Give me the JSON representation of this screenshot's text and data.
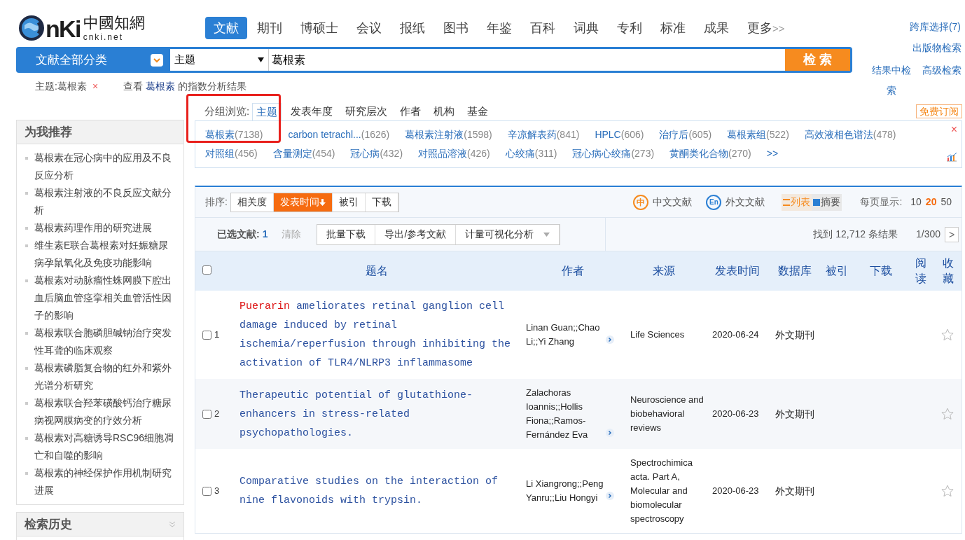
{
  "logo": {
    "letters": "nKi",
    "name": "中國知網",
    "domain": "cnki.net"
  },
  "nav": [
    {
      "label": "文献",
      "selected": true
    },
    {
      "label": "期刊",
      "selected": false
    },
    {
      "label": "博硕士",
      "selected": false
    },
    {
      "label": "会议",
      "selected": false
    },
    {
      "label": "报纸",
      "selected": false
    },
    {
      "label": "图书",
      "selected": false
    },
    {
      "label": "年鉴",
      "selected": false
    },
    {
      "label": "百科",
      "selected": false
    },
    {
      "label": "词典",
      "selected": false
    },
    {
      "label": "专利",
      "selected": false
    },
    {
      "label": "标准",
      "selected": false
    },
    {
      "label": "成果",
      "selected": false
    },
    {
      "label": "更多",
      "selected": false
    }
  ],
  "nav_more_icon": ">>",
  "search": {
    "category": "文献全部分类",
    "field": "主题",
    "value": "葛根素",
    "button": "检 索"
  },
  "right_links": [
    "跨库选择(7)",
    "出版物检索",
    "结果中检索",
    "高级检索"
  ],
  "filter": {
    "tag": "主题:葛根素",
    "remove": "×",
    "prefix": "查看",
    "keyword": "葛根素",
    "suffix": "的指数分析结果"
  },
  "sidebar": {
    "title": "为我推荐",
    "items": [
      "葛根素在冠心病中的应用及不良反应分析",
      "葛根素注射液的不良反应文献分析",
      "葛根素药理作用的研究进展",
      "维生素E联合葛根素对妊娠糖尿病孕鼠氧化及免疫功能影响",
      "葛根素对动脉瘤性蛛网膜下腔出血后脑血管痉挛相关血管活性因子的影响",
      "葛根素联合胞磷胆碱钠治疗突发性耳聋的临床观察",
      "葛根素磷脂复合物的红外和紫外光谱分析研究",
      "葛根素联合羟苯磺酸钙治疗糖尿病视网膜病变的疗效分析",
      "葛根素对高糖诱导RSC96细胞凋亡和自噬的影响",
      "葛根素的神经保护作用机制研究进展"
    ],
    "history_title": "检索历史"
  },
  "group_browse": {
    "label": "分组浏览:",
    "callout": true,
    "tabs": [
      {
        "label": "主题",
        "selected": true
      },
      {
        "label": "发表年度",
        "selected": false
      },
      {
        "label": "研究层次",
        "selected": false
      },
      {
        "label": "作者",
        "selected": false
      },
      {
        "label": "机构",
        "selected": false
      },
      {
        "label": "基金",
        "selected": false
      }
    ],
    "subscribe": "免费订阅",
    "close": "×",
    "terms": [
      {
        "name": "葛根素",
        "count": "(7138)"
      },
      {
        "name": "carbon tetrachl...",
        "count": "(1626)"
      },
      {
        "name": "葛根素注射液",
        "count": "(1598)"
      },
      {
        "name": "辛凉解表药",
        "count": "(841)"
      },
      {
        "name": "HPLC",
        "count": "(606)"
      },
      {
        "name": "治疗后",
        "count": "(605)"
      },
      {
        "name": "葛根素组",
        "count": "(522)"
      },
      {
        "name": "高效液相色谱法",
        "count": "(478)"
      },
      {
        "name": "对照组",
        "count": "(456)"
      },
      {
        "name": "含量测定",
        "count": "(454)"
      },
      {
        "name": "冠心病",
        "count": "(432)"
      },
      {
        "name": "对照品溶液",
        "count": "(426)"
      },
      {
        "name": "心绞痛",
        "count": "(311)"
      },
      {
        "name": "冠心病心绞痛",
        "count": "(273)"
      },
      {
        "name": "黄酮类化合物",
        "count": "(270)"
      }
    ],
    "more": ">>"
  },
  "sort": {
    "label": "排序:",
    "options": [
      {
        "label": "相关度",
        "selected": false
      },
      {
        "label": "发表时间",
        "selected": true
      },
      {
        "label": "被引",
        "selected": false
      },
      {
        "label": "下载",
        "selected": false
      }
    ]
  },
  "lang_filters": [
    {
      "kind": "zh",
      "icon": "中",
      "label": "中文文献"
    },
    {
      "kind": "en",
      "icon": "En",
      "label": "外文文献"
    }
  ],
  "view_modes": [
    {
      "label": "列表",
      "selected": true
    },
    {
      "label": "摘要",
      "selected": false
    }
  ],
  "page_size": {
    "label": "每页显示:",
    "options": [
      {
        "label": "10",
        "selected": false
      },
      {
        "label": "20",
        "selected": true
      },
      {
        "label": "50",
        "selected": false
      }
    ]
  },
  "selection": {
    "label": "已选文献:",
    "count": "1",
    "clear": "清除",
    "actions": [
      "批量下载",
      "导出/参考文献",
      "计量可视化分析"
    ],
    "found": "找到 12,712 条结果",
    "page": "1/300",
    "next": ">"
  },
  "select_all": {
    "checked": false
  },
  "columns": [
    "题名",
    "作者",
    "来源",
    "发表时间",
    "数据库",
    "被引",
    "下载",
    "阅读",
    "收藏"
  ],
  "rows": [
    {
      "num": "1",
      "checked": false,
      "title": [
        {
          "text": "Puerarin",
          "highlight": true
        },
        {
          "text": " ameliorates retinal ganglion cell damage induced by retinal ischemia/reperfusion through inhibiting the activation of TLR4/NLRP3 inflammasome",
          "highlight": false
        }
      ],
      "authors": "Linan Guan;;Chao Li;;Yi Zhang",
      "source": "Life Sciences",
      "date": "2020-06-24",
      "db": "外文期刊",
      "favorite": false
    },
    {
      "num": "2",
      "checked": false,
      "title": [
        {
          "text": "Therapeutic potential of glutathione-enhancers in stress-related psychopathologies.",
          "highlight": false
        }
      ],
      "authors": "Zalachoras Ioannis;;Hollis Fiona;;Ramos-Fernández Eva",
      "source": "Neuroscience and biobehavioral reviews",
      "date": "2020-06-23",
      "db": "外文期刊",
      "favorite": false
    },
    {
      "num": "3",
      "checked": false,
      "title": [
        {
          "text": "Comparative studies on the interaction of nine flavonoids with trypsin.",
          "highlight": false
        }
      ],
      "authors": "Li Xiangrong;;Peng Yanru;;Liu Hongyi",
      "source": "Spectrochimica acta. Part A, Molecular and biomolecular spectroscopy",
      "date": "2020-06-23",
      "db": "外文期刊",
      "favorite": false
    }
  ]
}
